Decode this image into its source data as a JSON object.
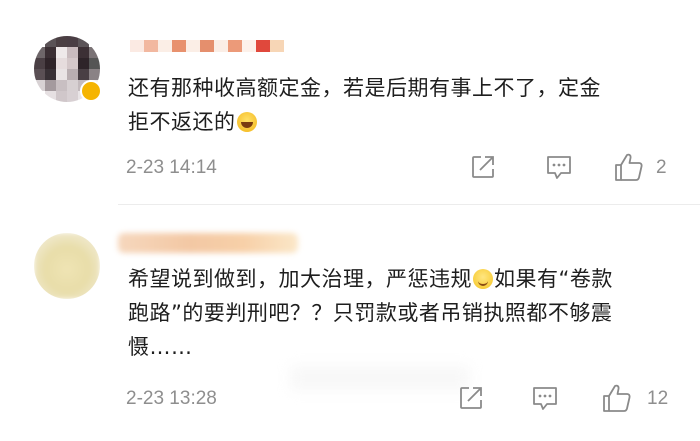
{
  "comments": [
    {
      "content": {
        "line1": "还有那种收高额定金，若是后期有事上不了，定金",
        "line2": "拒不返还的"
      },
      "emoji": "laughing-crying-emoji",
      "time": "2-23 14:14",
      "likes": "2",
      "icons": {
        "share": "share-icon",
        "reply": "reply-icon",
        "like": "thumbs-up-icon"
      }
    },
    {
      "content": {
        "line1a": "希望说到做到，加大治理，严惩违规",
        "line1b": "如果有“卷款",
        "line2": "跑路”的要判刑吧？？只罚款或者吊销执照都不够震",
        "line3": "慑……"
      },
      "emoji": "smiling-emoji",
      "time": "2-23 13:28",
      "likes": "12",
      "icons": {
        "share": "share-icon",
        "reply": "reply-icon",
        "like": "thumbs-up-icon"
      }
    }
  ],
  "colors": {
    "text": "#1e1e1e",
    "meta": "#8e8e8e",
    "icon": "#8a8a8a",
    "divider": "#ececec",
    "vip_badge": "#f5b400"
  }
}
